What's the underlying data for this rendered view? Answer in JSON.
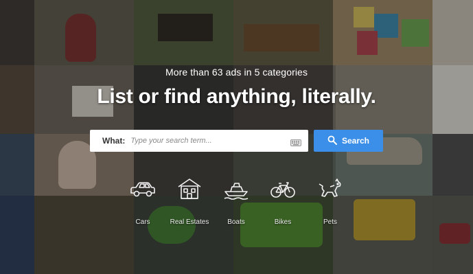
{
  "hero": {
    "tagline": "More than 63 ads in 5 categories",
    "headline": "List or find anything, literally."
  },
  "search": {
    "label": "What:",
    "placeholder": "Type your search term...",
    "button_label": "Search",
    "keyboard_icon": "keyboard-icon",
    "button_icon": "search-icon"
  },
  "categories": [
    {
      "label": "Cars",
      "icon": "car-icon"
    },
    {
      "label": "Real Estates",
      "icon": "house-icon"
    },
    {
      "label": "Boats",
      "icon": "boat-icon"
    },
    {
      "label": "Bikes",
      "icon": "bicycle-icon"
    },
    {
      "label": "Pets",
      "icon": "pet-icon"
    }
  ],
  "colors": {
    "accent": "#3c8fe8",
    "text": "#ffffff",
    "background": "#1c1c1c"
  }
}
